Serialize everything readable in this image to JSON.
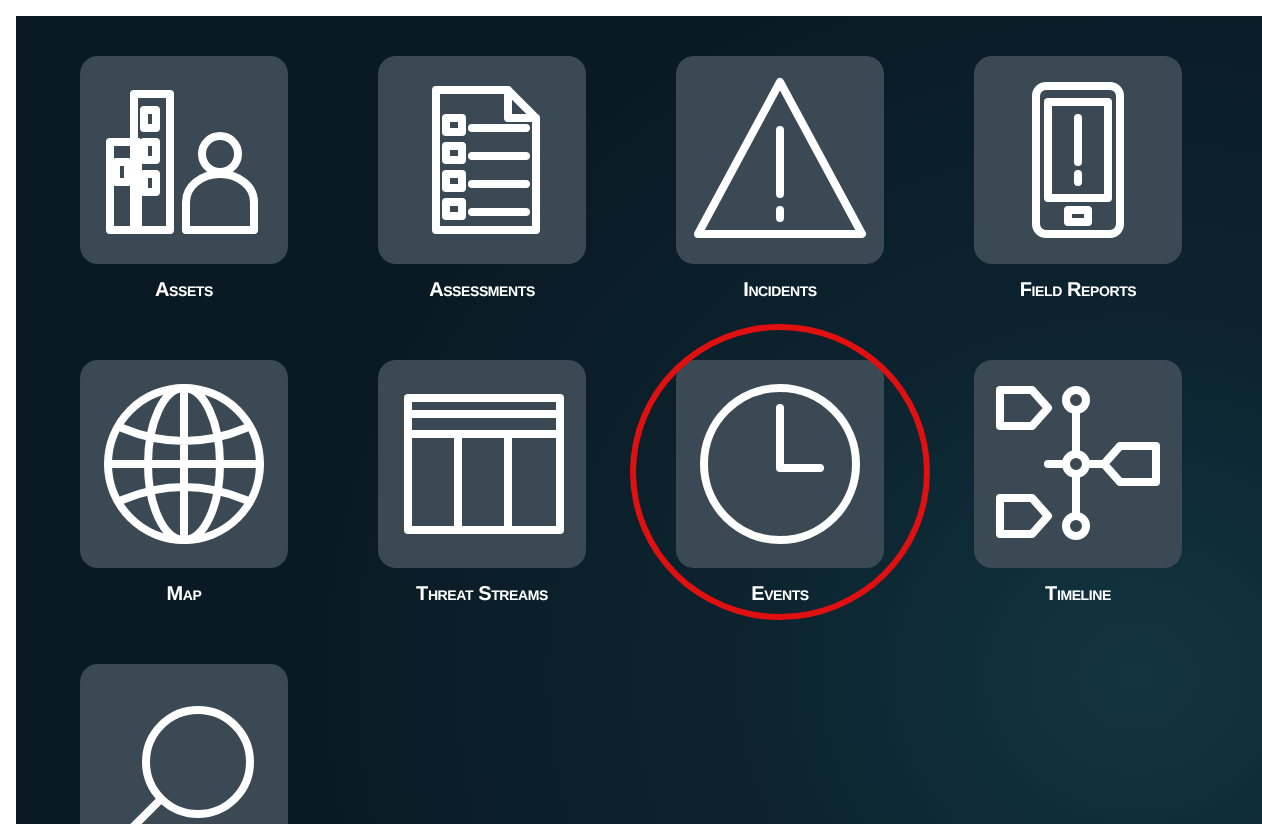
{
  "tiles": [
    {
      "kind": "assets",
      "label": "Assets",
      "highlighted": false
    },
    {
      "kind": "assessments",
      "label": "Assessments",
      "highlighted": false
    },
    {
      "kind": "incidents",
      "label": "Incidents",
      "highlighted": false
    },
    {
      "kind": "field-reports",
      "label": "Field Reports",
      "highlighted": false
    },
    {
      "kind": "map",
      "label": "Map",
      "highlighted": false
    },
    {
      "kind": "threat-streams",
      "label": "Threat Streams",
      "highlighted": false
    },
    {
      "kind": "events",
      "label": "Events",
      "highlighted": true
    },
    {
      "kind": "timeline",
      "label": "Timeline",
      "highlighted": false
    },
    {
      "kind": "search",
      "highlighted": false
    }
  ]
}
